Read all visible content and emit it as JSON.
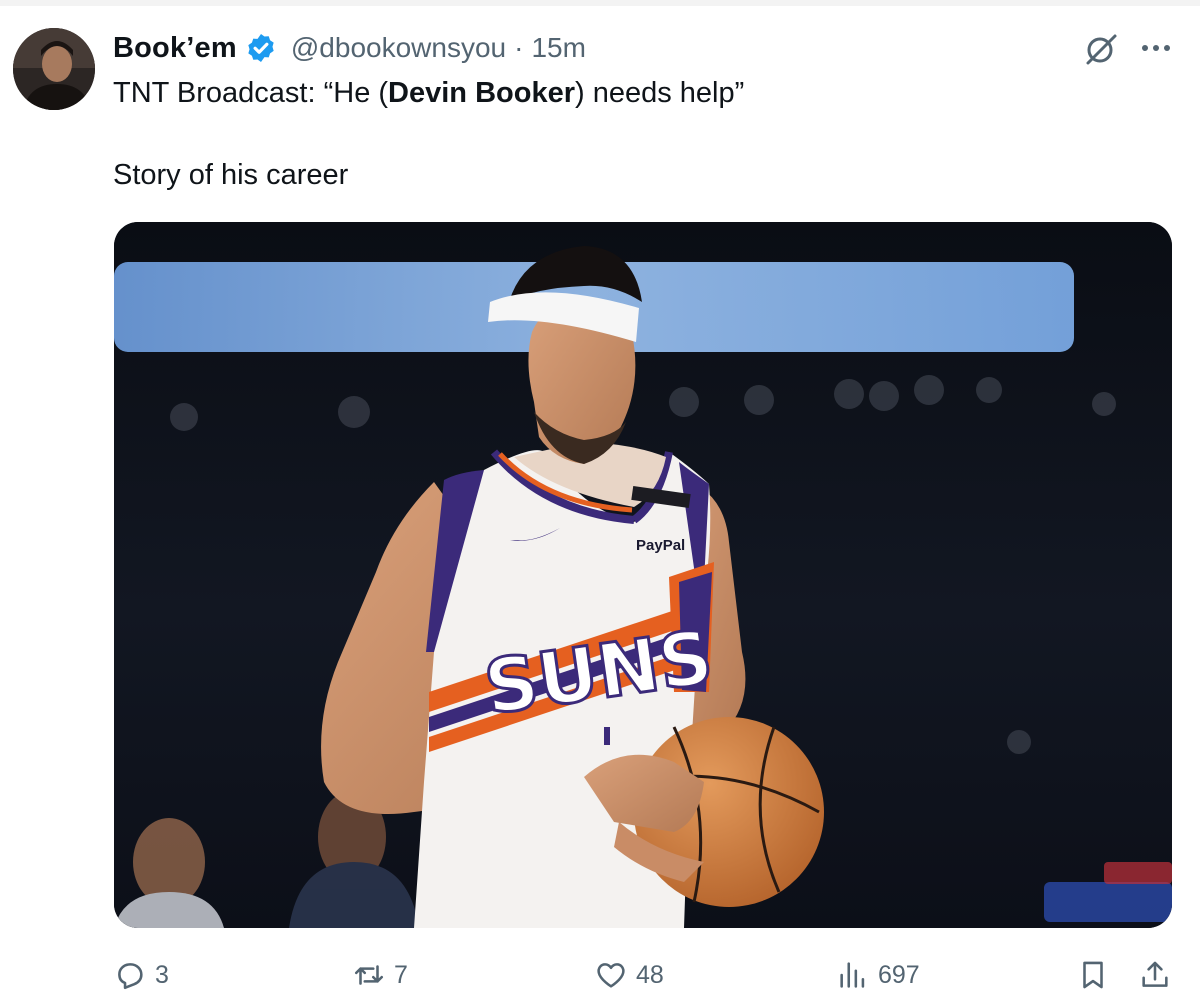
{
  "author": {
    "display_name": "Book’em",
    "handle": "@dbookownsyou",
    "separator": "·",
    "time": "15m"
  },
  "tweet": {
    "line1_prefix": "TNT Broadcast: “He (",
    "line1_bold": "Devin Booker",
    "line1_suffix": ") needs help”",
    "line2": "Story of his career"
  },
  "media": {
    "jersey_text": "SUNS",
    "sponsor": "PayPal"
  },
  "actions": {
    "replies": "3",
    "reposts": "7",
    "likes": "48",
    "views": "697"
  },
  "icons": [
    "verified-badge-icon",
    "grok-icon",
    "more-icon",
    "reply-icon",
    "repost-icon",
    "like-icon",
    "views-icon",
    "bookmark-icon",
    "share-icon"
  ],
  "colors": {
    "verified": "#1d9bf0",
    "text_primary": "#0f1419",
    "text_secondary": "#536471",
    "suns_purple": "#3b2a7a",
    "suns_orange": "#e56020"
  }
}
